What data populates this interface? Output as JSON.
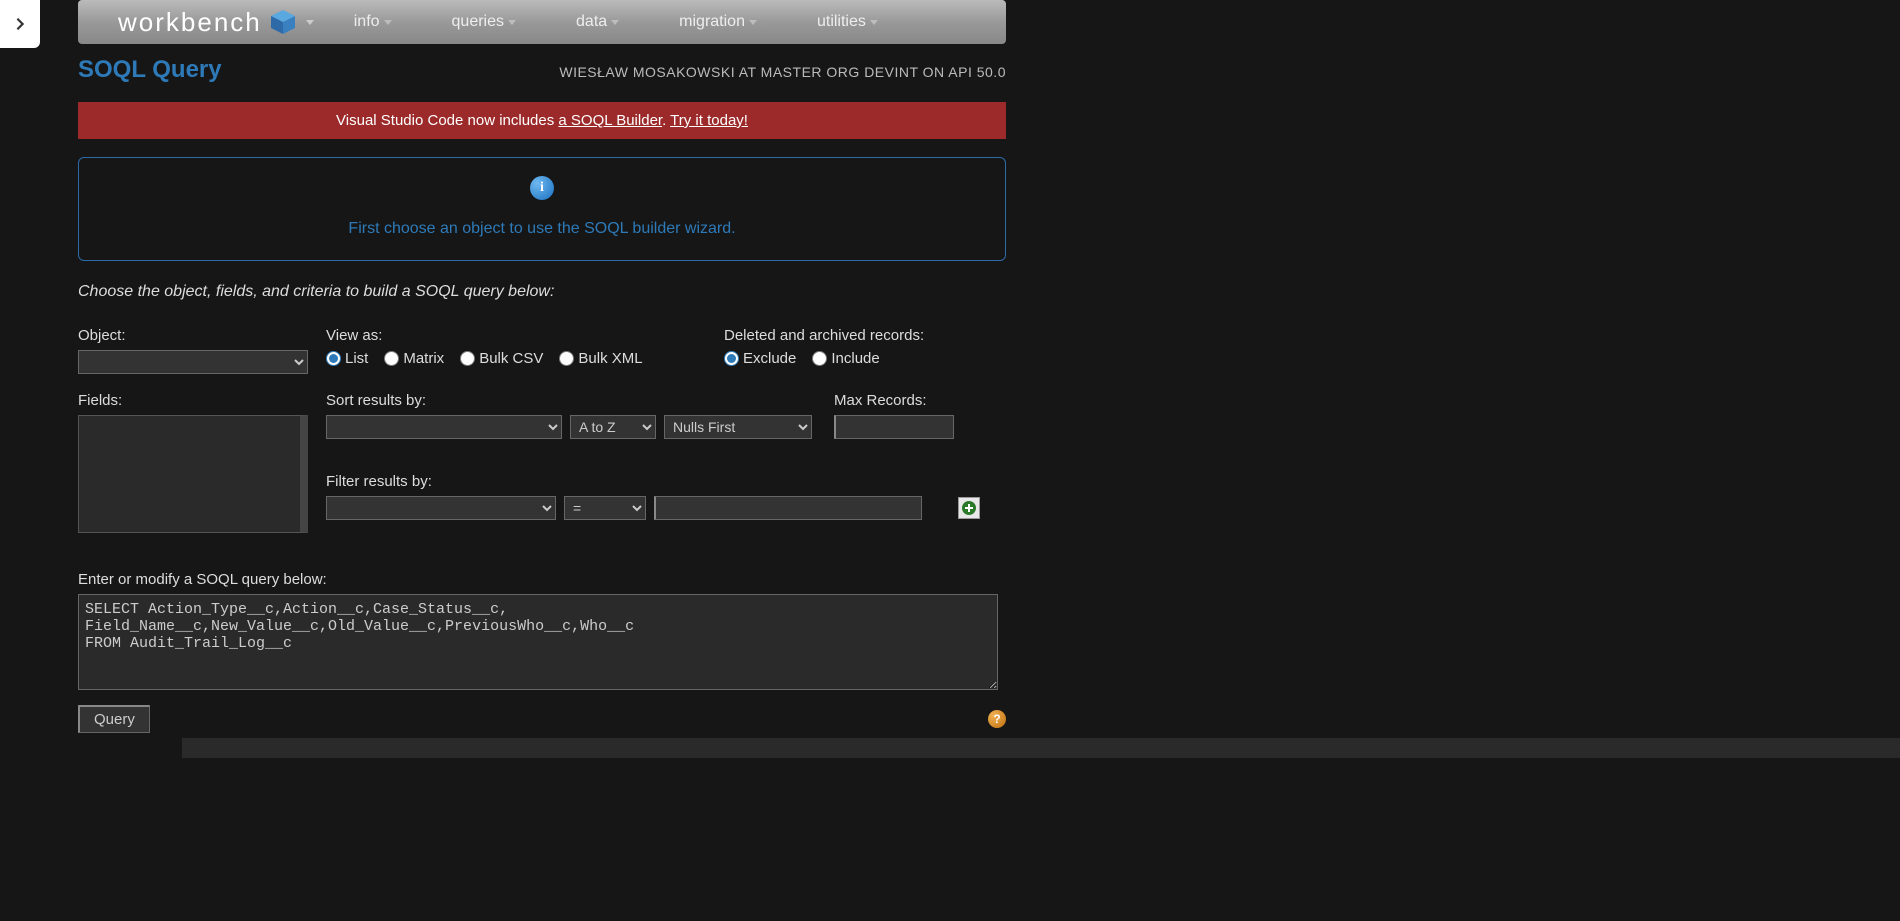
{
  "brand": "workbench",
  "nav": [
    "info",
    "queries",
    "data",
    "migration",
    "utilities"
  ],
  "page_title": "SOQL Query",
  "user_line": "WIESŁAW MOSAKOWSKI AT MASTER ORG DEVINT ON API 50.0",
  "announce": {
    "prefix": "Visual Studio Code now includes ",
    "link1": "a SOQL Builder",
    "mid": ". ",
    "link2": "Try it today!"
  },
  "info_text": "First choose an object to use the SOQL builder wizard.",
  "instruction": "Choose the object, fields, and criteria to build a SOQL query below:",
  "labels": {
    "object": "Object:",
    "fields": "Fields:",
    "view_as": "View as:",
    "deleted": "Deleted and archived records:",
    "sort": "Sort results by:",
    "max": "Max Records:",
    "filter": "Filter results by:",
    "enter_query": "Enter or modify a SOQL query below:"
  },
  "view_as_options": [
    "List",
    "Matrix",
    "Bulk CSV",
    "Bulk XML"
  ],
  "deleted_options": [
    "Exclude",
    "Include"
  ],
  "sort_dir": "A to Z",
  "sort_nulls": "Nulls First",
  "filter_op": "=",
  "query_text": "SELECT Action_Type__c,Action__c,Case_Status__c, Field_Name__c,New_Value__c,Old_Value__c,PreviousWho__c,Who__c\nFROM Audit_Trail_Log__c",
  "query_btn": "Query"
}
